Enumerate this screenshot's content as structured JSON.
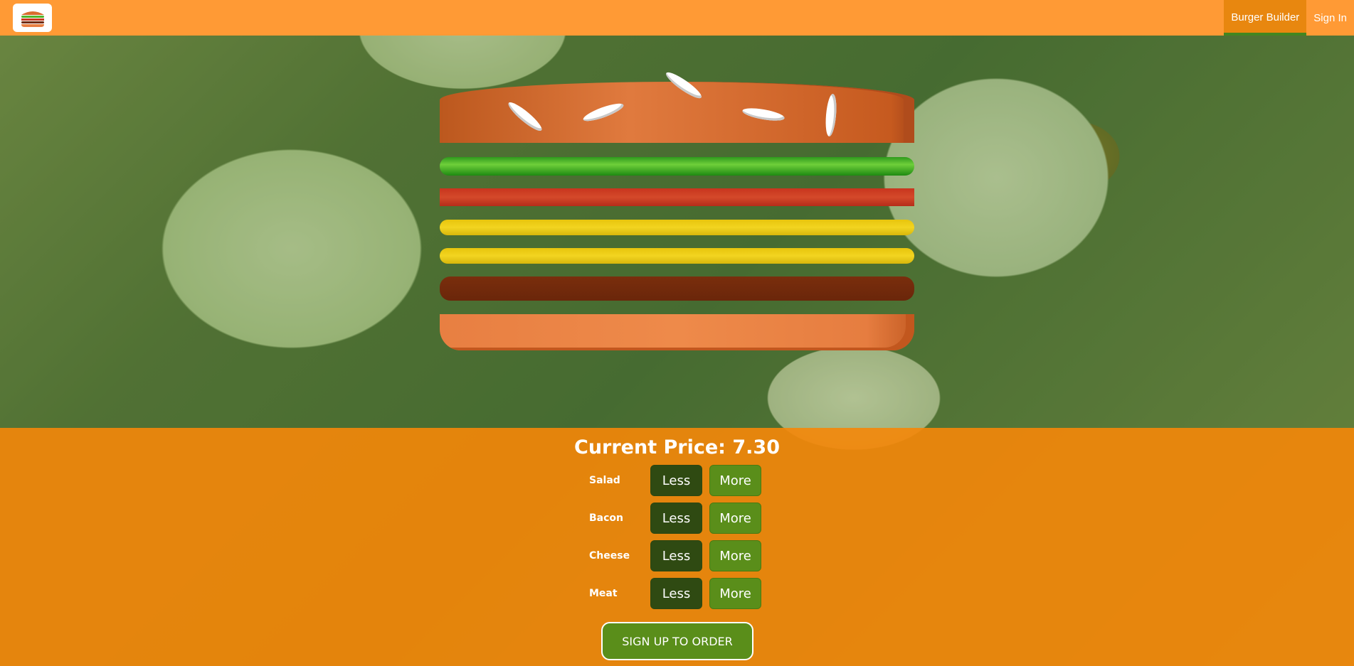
{
  "toolbar": {
    "logo": "burger-logo-icon",
    "nav": [
      {
        "label": "Burger Builder",
        "active": true
      },
      {
        "label": "Sign In",
        "active": false
      }
    ],
    "color": "#ff9a35"
  },
  "burger": {
    "ingredients": [
      "bread-top",
      "salad",
      "bacon",
      "cheese",
      "cheese",
      "meat",
      "bread-bottom"
    ],
    "colors": {
      "bread": "#d96d2f",
      "salad": "#4fb52a",
      "bacon": "#c83a22",
      "cheese": "#ecc913",
      "meat": "#702a0c"
    }
  },
  "controls": {
    "price_label": "Current Price: 7.30",
    "rows": [
      {
        "label": "Salad",
        "less": "Less",
        "more": "More"
      },
      {
        "label": "Bacon",
        "less": "Less",
        "more": "More"
      },
      {
        "label": "Cheese",
        "less": "Less",
        "more": "More"
      },
      {
        "label": "Meat",
        "less": "Less",
        "more": "More"
      }
    ],
    "order_button": "SIGN UP TO ORDER"
  }
}
